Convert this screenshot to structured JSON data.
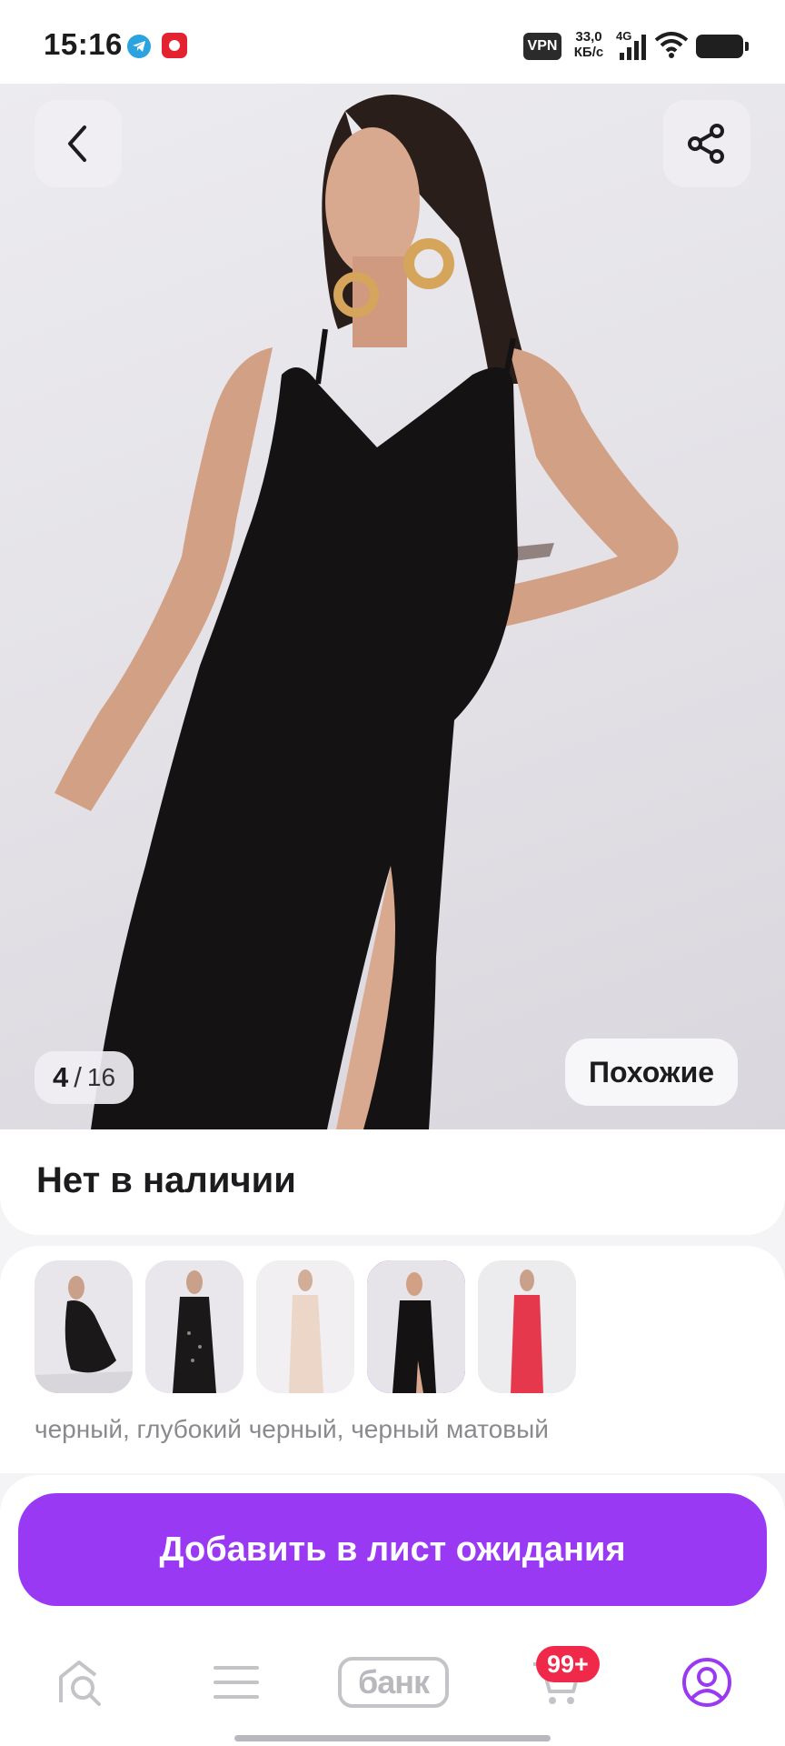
{
  "status_bar": {
    "time": "15:16",
    "vpn": "VPN",
    "speed_value": "33,0",
    "speed_unit": "КБ/с",
    "network": "4G",
    "icons": [
      "telegram-icon",
      "app-notification-icon",
      "signal-icon",
      "wifi-icon",
      "battery-icon"
    ]
  },
  "product": {
    "image_counter": {
      "current": "4",
      "total": "16"
    },
    "similar_button": "Похожие",
    "availability": "Нет в наличии",
    "color_names": "черный, глубокий черный, черный матовый",
    "variant_thumbnails": [
      {
        "label": "black-dress-sitting",
        "selected": false
      },
      {
        "label": "black-sequin-dress",
        "selected": false
      },
      {
        "label": "beige-dress",
        "selected": false
      },
      {
        "label": "black-slit-dress",
        "selected": true
      },
      {
        "label": "red-dress",
        "selected": false
      }
    ]
  },
  "actions": {
    "waitlist_button": "Добавить в лист ожидания"
  },
  "bottom_nav": {
    "items": [
      "home-search",
      "catalog",
      "bank",
      "cart",
      "profile"
    ],
    "bank_label": "банк",
    "cart_badge": "99+",
    "active": "profile"
  },
  "colors": {
    "accent": "#9a39f4",
    "badge": "#f0284a",
    "muted_text": "#8a8a8e"
  }
}
